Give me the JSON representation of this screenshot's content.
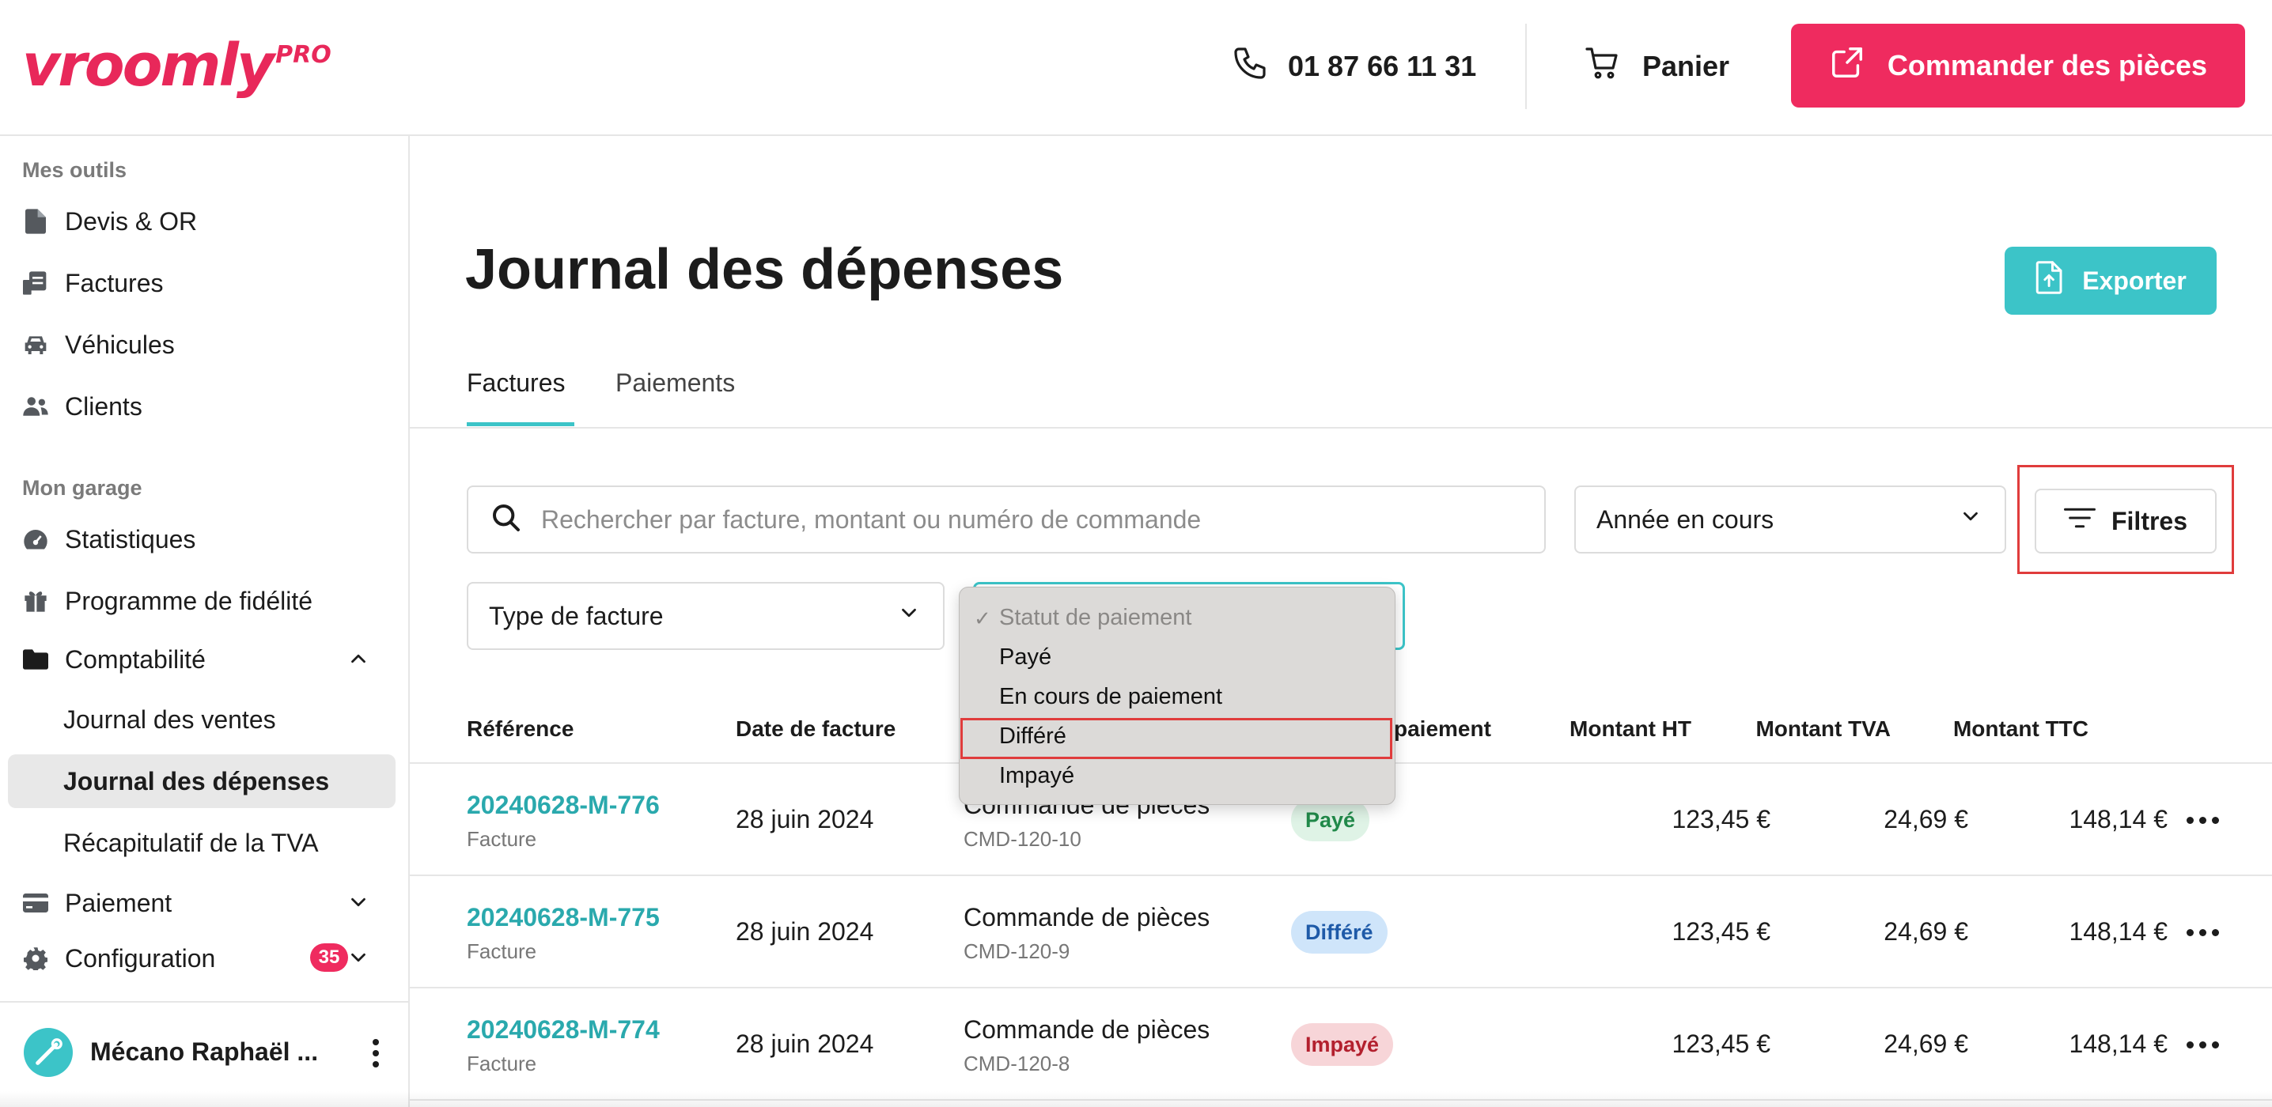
{
  "header": {
    "logo": "vroomly",
    "logo_suffix": "PRO",
    "phone": "01 87 66 11 31",
    "cart_label": "Panier",
    "order_button": "Commander des pièces",
    "phone_icon": "phone-icon",
    "cart_icon": "cart-icon",
    "external_link_icon": "external-link-icon"
  },
  "sidebar": {
    "section_tools": "Mes outils",
    "tools": [
      {
        "label": "Devis & OR",
        "icon": "document-icon"
      },
      {
        "label": "Factures",
        "icon": "invoice-icon"
      },
      {
        "label": "Véhicules",
        "icon": "car-icon"
      },
      {
        "label": "Clients",
        "icon": "users-icon"
      }
    ],
    "section_garage": "Mon garage",
    "garage": [
      {
        "label": "Statistiques",
        "icon": "gauge-icon"
      },
      {
        "label": "Programme de fidélité",
        "icon": "gift-icon"
      },
      {
        "label": "Comptabilité",
        "icon": "folder-icon"
      }
    ],
    "comptabilite_sub": [
      {
        "label": "Journal des ventes"
      },
      {
        "label": "Journal des dépenses"
      },
      {
        "label": "Récapitulatif de la TVA"
      }
    ],
    "paiement": {
      "label": "Paiement",
      "icon": "credit-card-icon"
    },
    "configuration": {
      "label": "Configuration",
      "icon": "gear-icon",
      "badge": "35"
    },
    "user": {
      "name": "Mécano Raphaël ..."
    }
  },
  "main": {
    "title": "Journal des dépenses",
    "export_button": "Exporter",
    "tabs": [
      {
        "label": "Factures",
        "active": true
      },
      {
        "label": "Paiements",
        "active": false
      }
    ],
    "search": {
      "placeholder": "Rechercher par facture, montant ou numéro de commande",
      "value": ""
    },
    "year_select": "Année en cours",
    "filters_button": "Filtres",
    "type_select": "Type de facture",
    "status_select": "Statut de paiement"
  },
  "status_dropdown": {
    "options": [
      "Statut de paiement",
      "Payé",
      "En cours de paiement",
      "Différé",
      "Impayé"
    ],
    "selected": "Statut de paiement",
    "checkmark": "✓"
  },
  "table": {
    "headers": {
      "reference": "Référence",
      "date": "Date de facture",
      "status": "paiement",
      "ht": "Montant HT",
      "tva": "Montant TVA",
      "ttc": "Montant TTC"
    },
    "rows": [
      {
        "ref": "20240628-M-776",
        "type": "Facture",
        "date": "28 juin 2024",
        "description": "Commande de pièces",
        "order": "CMD-120-10",
        "status": "Payé",
        "ht": "123,45 €",
        "tva": "24,69 €",
        "ttc": "148,14 €"
      },
      {
        "ref": "20240628-M-775",
        "type": "Facture",
        "date": "28 juin 2024",
        "description": "Commande de pièces",
        "order": "CMD-120-9",
        "status": "Différé",
        "ht": "123,45 €",
        "tva": "24,69 €",
        "ttc": "148,14 €"
      },
      {
        "ref": "20240628-M-774",
        "type": "Facture",
        "date": "28 juin 2024",
        "description": "Commande de pièces",
        "order": "CMD-120-8",
        "status": "Impayé",
        "ht": "123,45 €",
        "tva": "24,69 €",
        "ttc": "148,14 €"
      }
    ]
  },
  "colors": {
    "brand": "#ef2b5f",
    "accent": "#3cc4c8",
    "link": "#2aa9ad",
    "highlight": "#e03c3c"
  }
}
